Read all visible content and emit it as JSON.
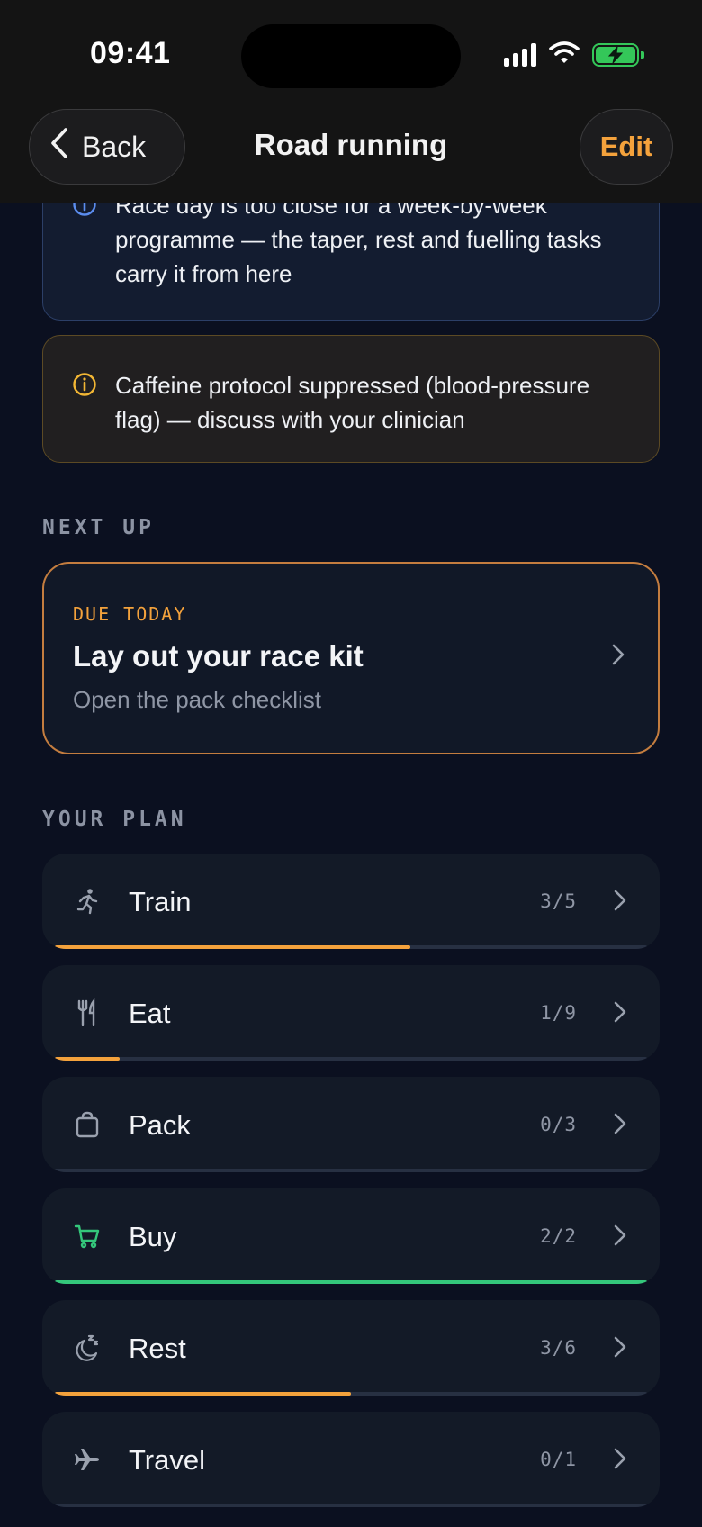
{
  "status_bar": {
    "time": "09:41"
  },
  "nav": {
    "back_label": "Back",
    "title": "Road running",
    "edit_label": "Edit"
  },
  "banners": [
    {
      "kind": "info",
      "icon": "info-icon",
      "text": "Race day is too close for a week-by-week programme — the taper, rest and fuelling tasks carry it from here"
    },
    {
      "kind": "warning",
      "icon": "info-icon",
      "text": "Caffeine protocol suppressed (blood-pressure flag) — discuss with your clinician"
    }
  ],
  "next_up": {
    "section_label": "NEXT UP",
    "due_label": "DUE TODAY",
    "title": "Lay out your race kit",
    "subtitle": "Open the pack checklist"
  },
  "plan": {
    "section_label": "YOUR PLAN",
    "items": [
      {
        "label": "Train",
        "count": "3/5",
        "icon": "running-icon",
        "progress": 0.6,
        "color": "#f4a23c"
      },
      {
        "label": "Eat",
        "count": "1/9",
        "icon": "utensils-icon",
        "progress": 0.11,
        "color": "#f4a23c"
      },
      {
        "label": "Pack",
        "count": "0/3",
        "icon": "bag-icon",
        "progress": 0,
        "color": "#f4a23c"
      },
      {
        "label": "Buy",
        "count": "2/2",
        "icon": "cart-icon",
        "progress": 1.0,
        "color": "#34c77b"
      },
      {
        "label": "Rest",
        "count": "3/6",
        "icon": "moon-icon",
        "progress": 0.5,
        "color": "#f4a23c"
      },
      {
        "label": "Travel",
        "count": "0/1",
        "icon": "plane-icon",
        "progress": 0,
        "color": "#f4a23c"
      }
    ]
  },
  "colors": {
    "accent": "#f4a23c",
    "success": "#34c77b",
    "background": "#0b1020",
    "card": "#131a27"
  }
}
